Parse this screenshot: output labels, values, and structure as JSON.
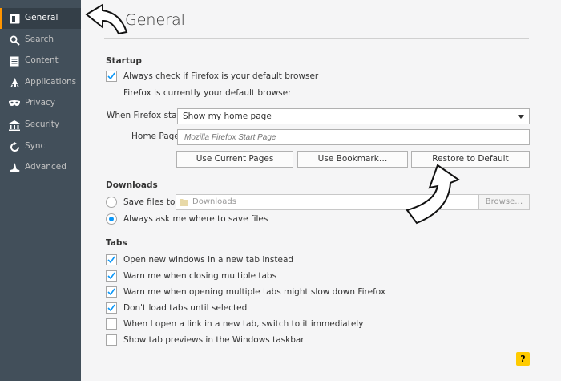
{
  "sidebar": {
    "items": [
      {
        "label": "General",
        "icon": "general-icon",
        "selected": true
      },
      {
        "label": "Search",
        "icon": "search-icon"
      },
      {
        "label": "Content",
        "icon": "content-icon"
      },
      {
        "label": "Applications",
        "icon": "applications-icon"
      },
      {
        "label": "Privacy",
        "icon": "privacy-mask-icon"
      },
      {
        "label": "Security",
        "icon": "security-lock-icon"
      },
      {
        "label": "Sync",
        "icon": "sync-icon"
      },
      {
        "label": "Advanced",
        "icon": "advanced-wizard-icon"
      }
    ]
  },
  "page": {
    "title": "General"
  },
  "startup": {
    "heading": "Startup",
    "default_check_label": "Always check if Firefox is your default browser",
    "default_check_checked": true,
    "default_status": "Firefox is currently your default browser",
    "when_starts_label": "When Firefox starts:",
    "when_starts_value": "Show my home page",
    "home_page_label": "Home Page:",
    "home_page_placeholder": "Mozilla Firefox Start Page",
    "buttons": {
      "use_current": "Use Current Pages",
      "use_bookmark": "Use Bookmark…",
      "restore_default": "Restore to Default"
    }
  },
  "downloads": {
    "heading": "Downloads",
    "save_files_label": "Save files to",
    "save_path": "Downloads",
    "browse": "Browse…",
    "always_ask_label": "Always ask me where to save files",
    "selected_option": "always_ask"
  },
  "tabs": {
    "heading": "Tabs",
    "options": [
      {
        "label": "Open new windows in a new tab instead",
        "checked": true
      },
      {
        "label": "Warn me when closing multiple tabs",
        "checked": true
      },
      {
        "label": "Warn me when opening multiple tabs might slow down Firefox",
        "checked": true
      },
      {
        "label": "Don't load tabs until selected",
        "checked": true
      },
      {
        "label": "When I open a link in a new tab, switch to it immediately",
        "checked": false
      },
      {
        "label": "Show tab previews in the Windows taskbar",
        "checked": false
      }
    ]
  },
  "help": {
    "label": "?"
  },
  "colors": {
    "sidebar": "#424f5a",
    "selected": "#343f48",
    "accent": "#0996f8",
    "help": "#ffcb00"
  }
}
